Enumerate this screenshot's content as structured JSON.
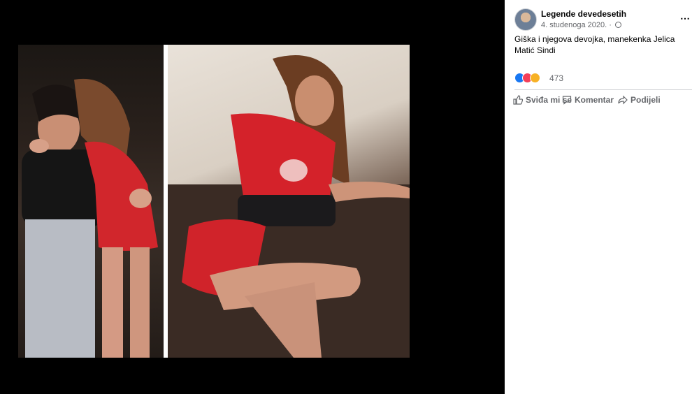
{
  "post": {
    "page_name": "Legende devedesetih",
    "date": "4. studenoga 2020.",
    "separator": " · ",
    "caption": "Giška i njegova devojka, manekenka Jelica Matić Sindi",
    "reaction_count": "473",
    "reactions": [
      "like-icon",
      "love-icon",
      "haha-icon"
    ]
  },
  "actions": {
    "like_label": "Sviđa mi se",
    "comment_label": "Komentar",
    "share_label": "Podijeli"
  },
  "icons": {
    "more": "⋯"
  },
  "colors": {
    "viewer_bg": "#000000",
    "sidebar_bg": "#ffffff",
    "secondary_text": "#65676b",
    "like_blue": "#1877f2",
    "love_red": "#f33e58",
    "haha_yellow": "#f7b125"
  }
}
